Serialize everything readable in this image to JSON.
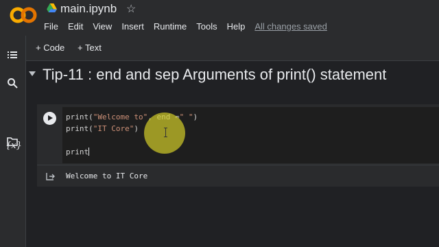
{
  "app": {
    "logo_text": "CO",
    "notebook_title": "main.ipynb",
    "icons": {
      "drive": "drive-icon",
      "star": "star-icon"
    }
  },
  "menu": {
    "items": [
      "File",
      "Edit",
      "View",
      "Insert",
      "Runtime",
      "Tools",
      "Help"
    ],
    "saved_status": "All changes saved"
  },
  "toolbar": {
    "add_code": "+ Code",
    "add_text": "+ Text"
  },
  "sidebar": {
    "icons": [
      "toc-icon",
      "search-icon",
      "variables-icon",
      "files-icon"
    ],
    "variables_label": "{x}"
  },
  "section": {
    "title": "Tip-11 : end and sep Arguments of print() statement"
  },
  "cell": {
    "lines": [
      {
        "fn": "print(",
        "str1": "\"Welcome to\"",
        "mid": ", end =",
        "str2": "\" \"",
        "end": ")"
      },
      {
        "fn": "print(",
        "str1": "\"IT Core\"",
        "end": ")"
      },
      {
        "text": "print"
      }
    ],
    "output": "Welcome to IT Core"
  },
  "colors": {
    "background": "#202124",
    "chrome": "#2b2c2e",
    "string": "#ce9178",
    "highlight": "#cdc828",
    "logo_orange": "#f9ab00"
  }
}
